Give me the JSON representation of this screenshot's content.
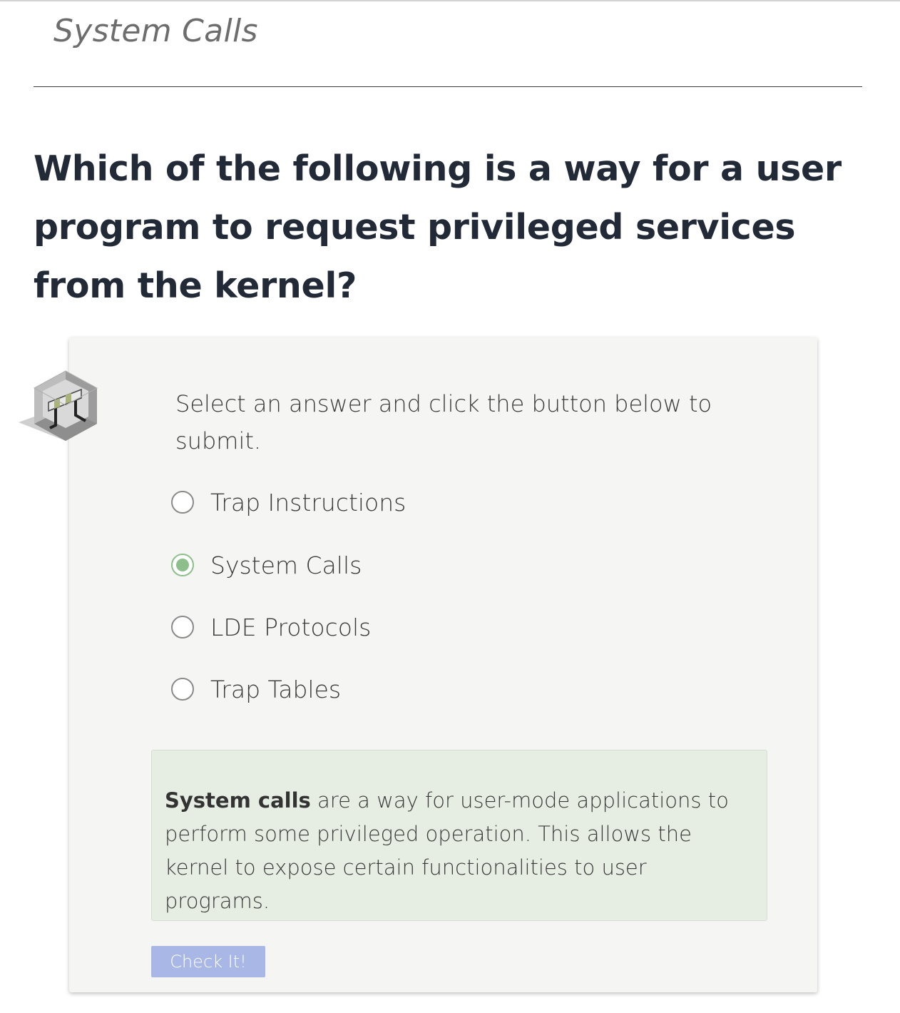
{
  "section_title": "System Calls",
  "question": "Which of the following is a way for a user program to request privileged services from the kernel?",
  "quiz": {
    "icon": "barrier-icon",
    "instructions": "Select an answer and click the button below to submit.",
    "options": [
      {
        "label": "Trap Instructions",
        "selected": false
      },
      {
        "label": "System Calls",
        "selected": true
      },
      {
        "label": "LDE Protocols",
        "selected": false
      },
      {
        "label": "Trap Tables",
        "selected": false
      }
    ],
    "feedback": {
      "bold": "System calls",
      "text": " are a way for user-mode applications to perform some privileged operation. This allows the kernel to expose certain functionalities to user programs."
    },
    "button_label": "Check It!"
  },
  "colors": {
    "selected_radio": "#8cbf8c",
    "feedback_bg": "#e6ede2",
    "button_bg": "#a9b7e6",
    "question_text": "#222a38"
  }
}
